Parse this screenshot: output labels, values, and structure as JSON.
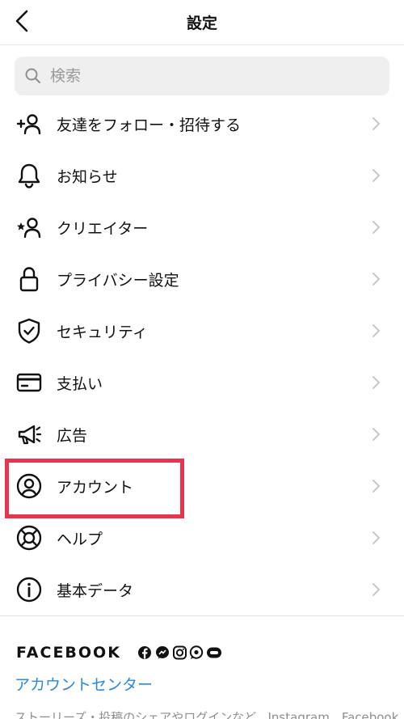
{
  "header": {
    "title": "設定"
  },
  "search": {
    "placeholder": "検索"
  },
  "menu": [
    {
      "label": "友達をフォロー・招待する",
      "icon": "add-person-icon"
    },
    {
      "label": "お知らせ",
      "icon": "bell-icon"
    },
    {
      "label": "クリエイター",
      "icon": "creator-star-person-icon"
    },
    {
      "label": "プライバシー設定",
      "icon": "lock-icon"
    },
    {
      "label": "セキュリティ",
      "icon": "shield-check-icon"
    },
    {
      "label": "支払い",
      "icon": "credit-card-icon"
    },
    {
      "label": "広告",
      "icon": "megaphone-icon"
    },
    {
      "label": "アカウント",
      "icon": "account-circle-icon"
    },
    {
      "label": "ヘルプ",
      "icon": "lifebuoy-icon"
    },
    {
      "label": "基本データ",
      "icon": "info-icon"
    }
  ],
  "highlight": {
    "target": "アカウント",
    "color": "#e8344f"
  },
  "footer": {
    "brand": "FACEBOOK",
    "account_center": "アカウントセンター",
    "note": "ストーリーズ・投稿のシェアやログインなど、Instagram、Facebook"
  },
  "colors": {
    "link": "#2d88d6",
    "chevron": "#c7c7c7",
    "search_bg": "#efefef"
  }
}
